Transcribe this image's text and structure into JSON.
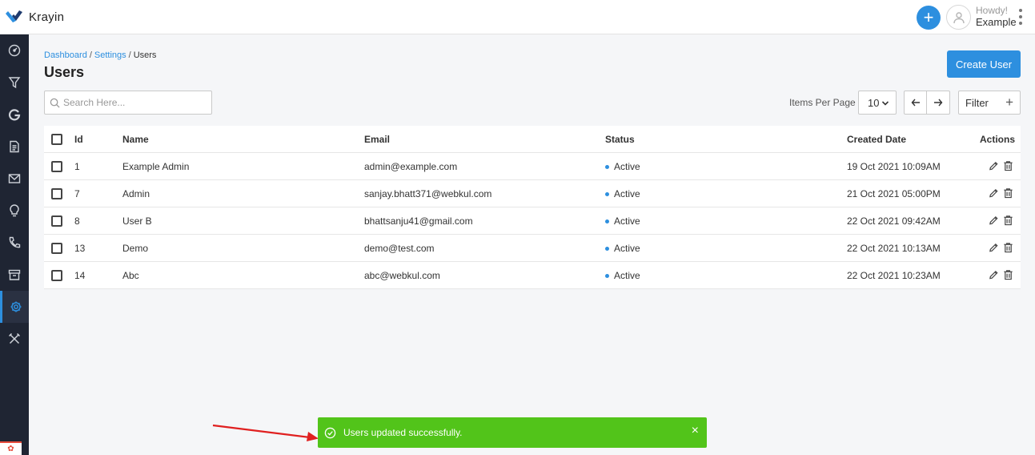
{
  "app": {
    "brand": "Krayin",
    "accent_color": "#2d8fdf",
    "sidebar_color": "#1f2533",
    "toast_color": "#52c41a"
  },
  "header": {
    "howdy": "Howdy!",
    "user_name": "Example",
    "add_icon": "plus-icon",
    "menu_icon": "kebab-icon"
  },
  "sidebar": {
    "items": [
      {
        "icon": "dashboard-icon",
        "active": false
      },
      {
        "icon": "filter-icon",
        "active": false
      },
      {
        "icon": "google-icon",
        "active": false
      },
      {
        "icon": "document-icon",
        "active": false
      },
      {
        "icon": "mail-icon",
        "active": false
      },
      {
        "icon": "lightbulb-icon",
        "active": false
      },
      {
        "icon": "phone-icon",
        "active": false
      },
      {
        "icon": "archive-icon",
        "active": false
      },
      {
        "icon": "settings-icon",
        "active": true
      },
      {
        "icon": "tools-icon",
        "active": false
      }
    ]
  },
  "breadcrumb": {
    "dashboard": "Dashboard",
    "settings": "Settings",
    "current": "Users",
    "separator": "/"
  },
  "page": {
    "title": "Users",
    "create_button": "Create User"
  },
  "toolbar": {
    "search_placeholder": "Search Here...",
    "items_per_page_label": "Items Per Page",
    "items_per_page_value": "10",
    "filter_label": "Filter"
  },
  "table": {
    "columns": {
      "id": "Id",
      "name": "Name",
      "email": "Email",
      "status": "Status",
      "created": "Created Date",
      "actions": "Actions"
    },
    "rows": [
      {
        "id": "1",
        "name": "Example Admin",
        "email": "admin@example.com",
        "status": "Active",
        "created": "19 Oct 2021 10:09AM"
      },
      {
        "id": "7",
        "name": "Admin",
        "email": "sanjay.bhatt371@webkul.com",
        "status": "Active",
        "created": "21 Oct 2021 05:00PM"
      },
      {
        "id": "8",
        "name": "User B",
        "email": "bhattsanju41@gmail.com",
        "status": "Active",
        "created": "22 Oct 2021 09:42AM"
      },
      {
        "id": "13",
        "name": "Demo",
        "email": "demo@test.com",
        "status": "Active",
        "created": "22 Oct 2021 10:13AM"
      },
      {
        "id": "14",
        "name": "Abc",
        "email": "abc@webkul.com",
        "status": "Active",
        "created": "22 Oct 2021 10:23AM"
      }
    ]
  },
  "toast": {
    "message": "Users updated successfully.",
    "close": "×"
  }
}
